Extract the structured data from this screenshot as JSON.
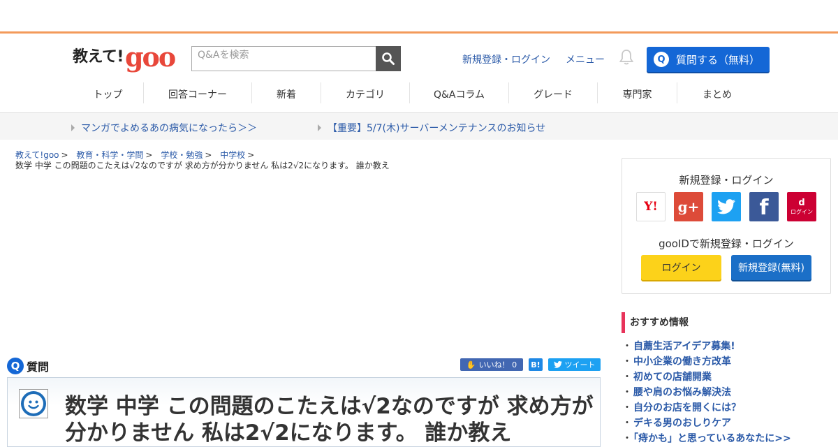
{
  "logo": {
    "jp": "教えて!",
    "goo": "goo"
  },
  "search": {
    "placeholder": "Q&Aを検索"
  },
  "header_links": [
    "新規登録・ログイン",
    "メニュー"
  ],
  "ask_button": {
    "q": "Q",
    "label": "質問する（無料）"
  },
  "global_nav": [
    "トップ",
    "回答コーナー",
    "新着",
    "カテゴリ",
    "Q&Aコラム",
    "グレード",
    "専門家",
    "まとめ"
  ],
  "notices": [
    "マンガでよめるあの病気になったら＞＞",
    "【重要】5/7(木)サーバーメンテナンスのお知らせ"
  ],
  "breadcrumb": {
    "items": [
      "教えて!goo",
      "教育・科学・学問",
      "学校・勉強",
      "中学校"
    ],
    "separator": ">",
    "current": "数学 中学 この問題のこたえは√2なのですが 求め方が分かりません 私は2√2になります。 誰か教え"
  },
  "question": {
    "header_icon": "Q",
    "header_label": "質問",
    "title": "数学 中学 この問題のこたえは√2なのですが 求め方が分かりません 私は2√2になります。 誰か教え"
  },
  "share": {
    "like_label": "いいね！ 0",
    "hatena_label": "B!",
    "tweet_label": "ツイート"
  },
  "login_box": {
    "title": "新規登録・ログイン",
    "sns": {
      "yahoo": "Y!",
      "google": "g+",
      "twitter": "",
      "facebook": "f",
      "docomo_text": "ログイン",
      "docomo_mark": "d"
    },
    "gooid_text": "gooIDで新規登録・ログイン",
    "login_button": "ログイン",
    "register_button": "新規登録(無料)"
  },
  "recommended": {
    "heading": "おすすめ情報",
    "items": [
      "自薦生活アイデア募集!",
      "中小企業の働き方改革",
      "初めての店舗開業",
      "腰や肩のお悩み解決法",
      "自分のお店を開くには？",
      "デキる男のおしりケア",
      "「痔かも」と思っているあなたに>>"
    ]
  },
  "colors": {
    "accent_orange": "#f39a5a",
    "brand_blue": "#1467d6",
    "link_blue": "#2b5aa8",
    "goo_red": "#e8473a",
    "rec_pink": "#e8335a"
  }
}
